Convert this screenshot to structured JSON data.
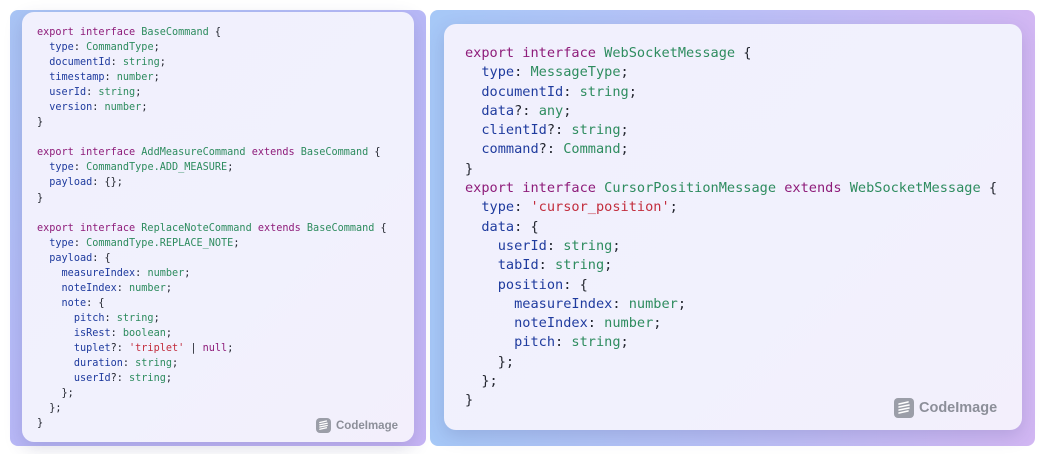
{
  "left_panel": {
    "lines": [
      [
        [
          "export",
          "kw"
        ],
        [
          " "
        ],
        [
          "interface",
          "kw"
        ],
        [
          " "
        ],
        [
          "BaseCommand",
          "ty"
        ],
        [
          " {"
        ]
      ],
      [
        [
          "  "
        ],
        [
          "type",
          "pr"
        ],
        [
          ": "
        ],
        [
          "CommandType",
          "ty"
        ],
        [
          ";"
        ]
      ],
      [
        [
          "  "
        ],
        [
          "documentId",
          "pr"
        ],
        [
          ": "
        ],
        [
          "string",
          "ty"
        ],
        [
          ";"
        ]
      ],
      [
        [
          "  "
        ],
        [
          "timestamp",
          "pr"
        ],
        [
          ": "
        ],
        [
          "number",
          "ty"
        ],
        [
          ";"
        ]
      ],
      [
        [
          "  "
        ],
        [
          "userId",
          "pr"
        ],
        [
          ": "
        ],
        [
          "string",
          "ty"
        ],
        [
          ";"
        ]
      ],
      [
        [
          "  "
        ],
        [
          "version",
          "pr"
        ],
        [
          ": "
        ],
        [
          "number",
          "ty"
        ],
        [
          ";"
        ]
      ],
      [
        [
          "}"
        ]
      ],
      [
        [
          ""
        ]
      ],
      [
        [
          "export",
          "kw"
        ],
        [
          " "
        ],
        [
          "interface",
          "kw"
        ],
        [
          " "
        ],
        [
          "AddMeasureCommand",
          "ty"
        ],
        [
          " "
        ],
        [
          "extends",
          "kw"
        ],
        [
          " "
        ],
        [
          "BaseCommand",
          "ty"
        ],
        [
          " {"
        ]
      ],
      [
        [
          "  "
        ],
        [
          "type",
          "pr"
        ],
        [
          ": "
        ],
        [
          "CommandType.ADD_MEASURE",
          "ty"
        ],
        [
          ";"
        ]
      ],
      [
        [
          "  "
        ],
        [
          "payload",
          "pr"
        ],
        [
          ": {};"
        ]
      ],
      [
        [
          "}"
        ]
      ],
      [
        [
          ""
        ]
      ],
      [
        [
          "export",
          "kw"
        ],
        [
          " "
        ],
        [
          "interface",
          "kw"
        ],
        [
          " "
        ],
        [
          "ReplaceNoteCommand",
          "ty"
        ],
        [
          " "
        ],
        [
          "extends",
          "kw"
        ],
        [
          " "
        ],
        [
          "BaseCommand",
          "ty"
        ],
        [
          " {"
        ]
      ],
      [
        [
          "  "
        ],
        [
          "type",
          "pr"
        ],
        [
          ": "
        ],
        [
          "CommandType.REPLACE_NOTE",
          "ty"
        ],
        [
          ";"
        ]
      ],
      [
        [
          "  "
        ],
        [
          "payload",
          "pr"
        ],
        [
          ": {"
        ]
      ],
      [
        [
          "    "
        ],
        [
          "measureIndex",
          "pr"
        ],
        [
          ": "
        ],
        [
          "number",
          "ty"
        ],
        [
          ";"
        ]
      ],
      [
        [
          "    "
        ],
        [
          "noteIndex",
          "pr"
        ],
        [
          ": "
        ],
        [
          "number",
          "ty"
        ],
        [
          ";"
        ]
      ],
      [
        [
          "    "
        ],
        [
          "note",
          "pr"
        ],
        [
          ": {"
        ]
      ],
      [
        [
          "      "
        ],
        [
          "pitch",
          "pr"
        ],
        [
          ": "
        ],
        [
          "string",
          "ty"
        ],
        [
          ";"
        ]
      ],
      [
        [
          "      "
        ],
        [
          "isRest",
          "pr"
        ],
        [
          ": "
        ],
        [
          "boolean",
          "ty"
        ],
        [
          ";"
        ]
      ],
      [
        [
          "      "
        ],
        [
          "tuplet",
          "pr"
        ],
        [
          "?: "
        ],
        [
          "'triplet'",
          "st"
        ],
        [
          " | "
        ],
        [
          "null",
          "kw"
        ],
        [
          ";"
        ]
      ],
      [
        [
          "      "
        ],
        [
          "duration",
          "pr"
        ],
        [
          ": "
        ],
        [
          "string",
          "ty"
        ],
        [
          ";"
        ]
      ],
      [
        [
          "      "
        ],
        [
          "userId",
          "pr"
        ],
        [
          "?: "
        ],
        [
          "string",
          "ty"
        ],
        [
          ";"
        ]
      ],
      [
        [
          "    };"
        ]
      ],
      [
        [
          "  };"
        ]
      ],
      [
        [
          "}"
        ]
      ]
    ],
    "brand": "CodeImage"
  },
  "right_panel": {
    "lines": [
      [
        [
          "export",
          "kw"
        ],
        [
          " "
        ],
        [
          "interface",
          "kw"
        ],
        [
          " "
        ],
        [
          "WebSocketMessage",
          "ty"
        ],
        [
          " {"
        ]
      ],
      [
        [
          "  "
        ],
        [
          "type",
          "pr"
        ],
        [
          ": "
        ],
        [
          "MessageType",
          "ty"
        ],
        [
          ";"
        ]
      ],
      [
        [
          "  "
        ],
        [
          "documentId",
          "pr"
        ],
        [
          ": "
        ],
        [
          "string",
          "ty"
        ],
        [
          ";"
        ]
      ],
      [
        [
          "  "
        ],
        [
          "data",
          "pr"
        ],
        [
          "?: "
        ],
        [
          "any",
          "ty"
        ],
        [
          ";"
        ]
      ],
      [
        [
          "  "
        ],
        [
          "clientId",
          "pr"
        ],
        [
          "?: "
        ],
        [
          "string",
          "ty"
        ],
        [
          ";"
        ]
      ],
      [
        [
          "  "
        ],
        [
          "command",
          "pr"
        ],
        [
          "?: "
        ],
        [
          "Command",
          "ty"
        ],
        [
          ";"
        ]
      ],
      [
        [
          "}"
        ]
      ],
      [
        [
          "export",
          "kw"
        ],
        [
          " "
        ],
        [
          "interface",
          "kw"
        ],
        [
          " "
        ],
        [
          "CursorPositionMessage",
          "ty"
        ],
        [
          " "
        ],
        [
          "extends",
          "kw"
        ],
        [
          " "
        ],
        [
          "WebSocketMessage",
          "ty"
        ],
        [
          " {"
        ]
      ],
      [
        [
          "  "
        ],
        [
          "type",
          "pr"
        ],
        [
          ": "
        ],
        [
          "'cursor_position'",
          "st"
        ],
        [
          ";"
        ]
      ],
      [
        [
          "  "
        ],
        [
          "data",
          "pr"
        ],
        [
          ": {"
        ]
      ],
      [
        [
          "    "
        ],
        [
          "userId",
          "pr"
        ],
        [
          ": "
        ],
        [
          "string",
          "ty"
        ],
        [
          ";"
        ]
      ],
      [
        [
          "    "
        ],
        [
          "tabId",
          "pr"
        ],
        [
          ": "
        ],
        [
          "string",
          "ty"
        ],
        [
          ";"
        ]
      ],
      [
        [
          "    "
        ],
        [
          "position",
          "pr"
        ],
        [
          ": {"
        ]
      ],
      [
        [
          "      "
        ],
        [
          "measureIndex",
          "pr"
        ],
        [
          ": "
        ],
        [
          "number",
          "ty"
        ],
        [
          ";"
        ]
      ],
      [
        [
          "      "
        ],
        [
          "noteIndex",
          "pr"
        ],
        [
          ": "
        ],
        [
          "number",
          "ty"
        ],
        [
          ";"
        ]
      ],
      [
        [
          "      "
        ],
        [
          "pitch",
          "pr"
        ],
        [
          ": "
        ],
        [
          "string",
          "ty"
        ],
        [
          ";"
        ]
      ],
      [
        [
          "    };"
        ]
      ],
      [
        [
          "  };"
        ]
      ],
      [
        [
          "}"
        ]
      ]
    ],
    "brand": "CodeImage"
  },
  "colors": {
    "keyword": "#8e1c7a",
    "type": "#2e8c5f",
    "property": "#1f3b9e",
    "string": "#c22d3d",
    "punctuation": "#23262f"
  },
  "icons": {
    "brand_logo": "codeimage-logo-icon"
  }
}
